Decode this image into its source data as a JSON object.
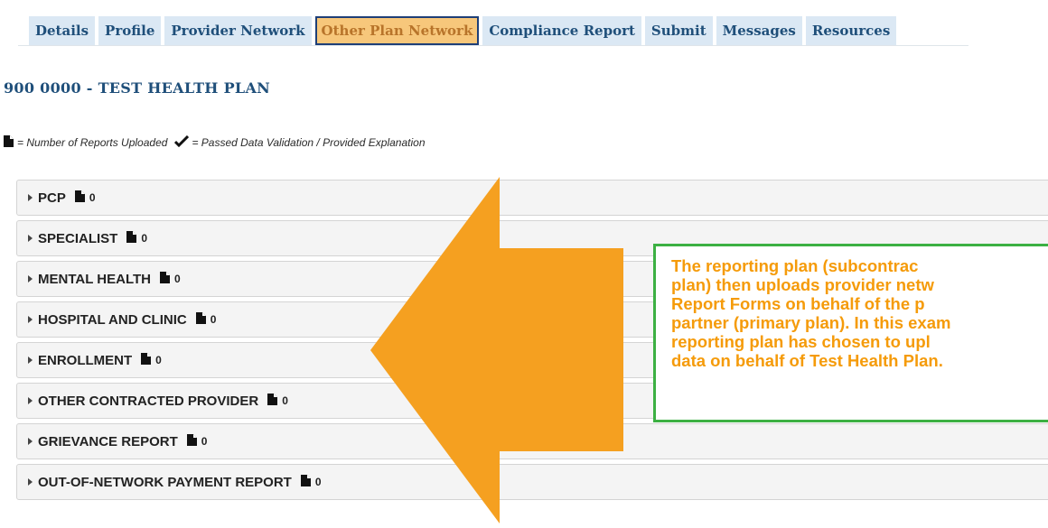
{
  "tabs": [
    {
      "label": "Details",
      "active": false
    },
    {
      "label": "Profile",
      "active": false
    },
    {
      "label": "Provider Network",
      "active": false
    },
    {
      "label": "Other Plan Network",
      "active": true
    },
    {
      "label": "Compliance Report",
      "active": false
    },
    {
      "label": "Submit",
      "active": false
    },
    {
      "label": "Messages",
      "active": false
    },
    {
      "label": "Resources",
      "active": false
    }
  ],
  "plan_title": "900  0000 - TEST HEALTH PLAN",
  "legend": {
    "reports_uploaded_label": "= Number of Reports Uploaded",
    "passed_validation_label": "= Passed Data Validation / Provided Explanation",
    "icons": [
      "document-icon",
      "checkmark-icon"
    ]
  },
  "sections": [
    {
      "label": "PCP",
      "count": "0"
    },
    {
      "label": "SPECIALIST",
      "count": "0"
    },
    {
      "label": "MENTAL HEALTH",
      "count": "0"
    },
    {
      "label": "HOSPITAL AND CLINIC",
      "count": "0"
    },
    {
      "label": "ENROLLMENT",
      "count": "0"
    },
    {
      "label": "OTHER CONTRACTED PROVIDER",
      "count": "0"
    },
    {
      "label": "GRIEVANCE REPORT",
      "count": "0"
    },
    {
      "label": "OUT-OF-NETWORK PAYMENT REPORT",
      "count": "0"
    }
  ],
  "callout": {
    "lines": [
      "The reporting plan (subcontrac",
      "plan) then uploads provider netw",
      "Report Forms on behalf of the p",
      "partner (primary plan). In this exam",
      "reporting plan has chosen to upl",
      "data on behalf of Test Health Plan."
    ]
  },
  "colors": {
    "tab_bg": "#dbe8f4",
    "tab_active_bg": "#f7c77b",
    "tab_text": "#1f4f7a",
    "arrow": "#f5a020",
    "callout_border": "#3cb043",
    "callout_text": "#f59b0a"
  }
}
